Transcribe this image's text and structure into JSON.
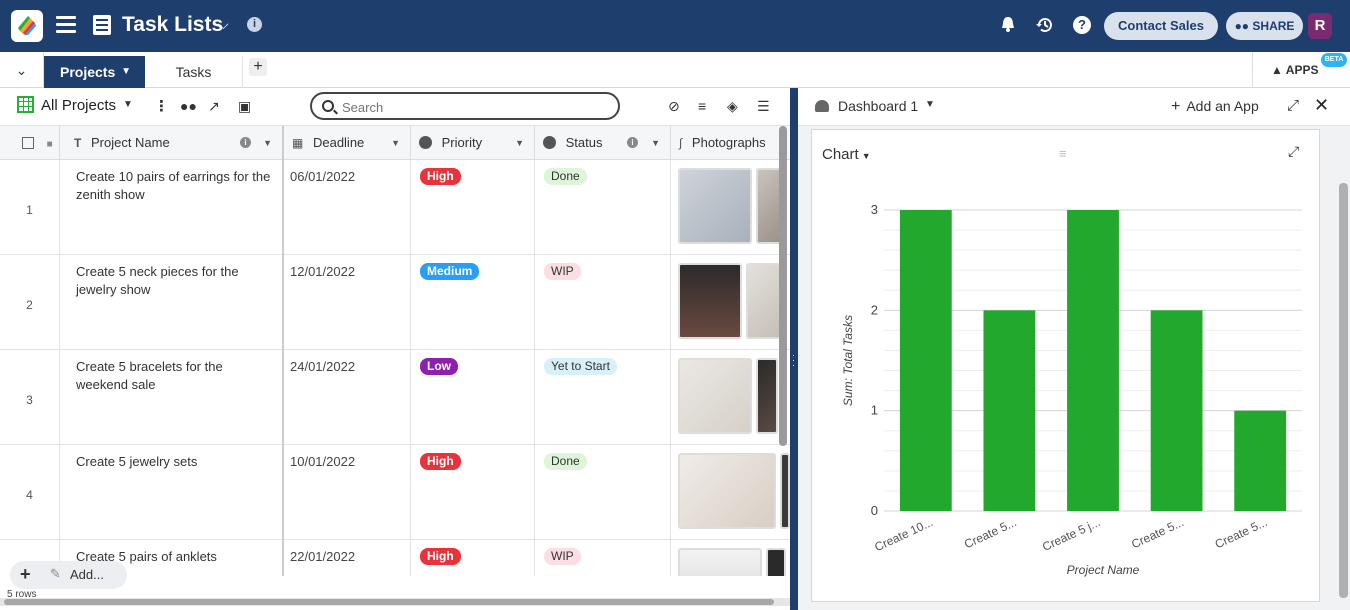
{
  "header": {
    "title": "Task Lists",
    "contact_label": "Contact Sales",
    "share_label": "SHARE",
    "avatar_initial": "R"
  },
  "tabs": {
    "items": [
      "Projects",
      "Tasks"
    ],
    "apps_label": "APPS",
    "beta_label": "BETA"
  },
  "toolbar": {
    "view_name": "All Projects",
    "search_placeholder": "Search"
  },
  "columns": [
    "Project Name",
    "Deadline",
    "Priority",
    "Status",
    "Photographs"
  ],
  "rows": [
    {
      "num": "1",
      "name": "Create 10 pairs of earrings for the zenith show",
      "deadline": "06/01/2022",
      "priority": "High",
      "priority_color": "#e8323c",
      "status": "Done",
      "status_bg": "#dff5d9"
    },
    {
      "num": "2",
      "name": "Create 5 neck pieces for the jewelry show",
      "deadline": "12/01/2022",
      "priority": "Medium",
      "priority_color": "#2a9ef2",
      "status": "WIP",
      "status_bg": "#fbdde4"
    },
    {
      "num": "3",
      "name": "Create 5 bracelets for the weekend sale",
      "deadline": "24/01/2022",
      "priority": "Low",
      "priority_color": "#8f1fb0",
      "status": "Yet to Start",
      "status_bg": "#d8f0fa"
    },
    {
      "num": "4",
      "name": "Create 5 jewelry sets",
      "deadline": "10/01/2022",
      "priority": "High",
      "priority_color": "#e8323c",
      "status": "Done",
      "status_bg": "#dff5d9"
    },
    {
      "num": "",
      "name": "Create 5 pairs of anklets",
      "deadline": "22/01/2022",
      "priority": "High",
      "priority_color": "#e8323c",
      "status": "WIP",
      "status_bg": "#fbdde4"
    }
  ],
  "footer": {
    "add_label": "Add...",
    "row_count": "5 rows"
  },
  "dashboard": {
    "title": "Dashboard 1",
    "add_app_label": "Add an App",
    "card_type": "Chart"
  },
  "chart_data": {
    "type": "bar",
    "categories": [
      "Create 10...",
      "Create 5...",
      "Create 5 j...",
      "Create 5...",
      "Create 5..."
    ],
    "values": [
      3,
      2,
      3,
      2,
      1
    ],
    "xlabel": "Project Name",
    "ylabel": "Sum: Total Tasks",
    "ylim": [
      0,
      3
    ],
    "yticks": [
      0,
      1,
      2,
      3
    ],
    "grid": true,
    "bar_color": "#22a82c"
  },
  "colors": {
    "brand": "#1e3f6e"
  }
}
